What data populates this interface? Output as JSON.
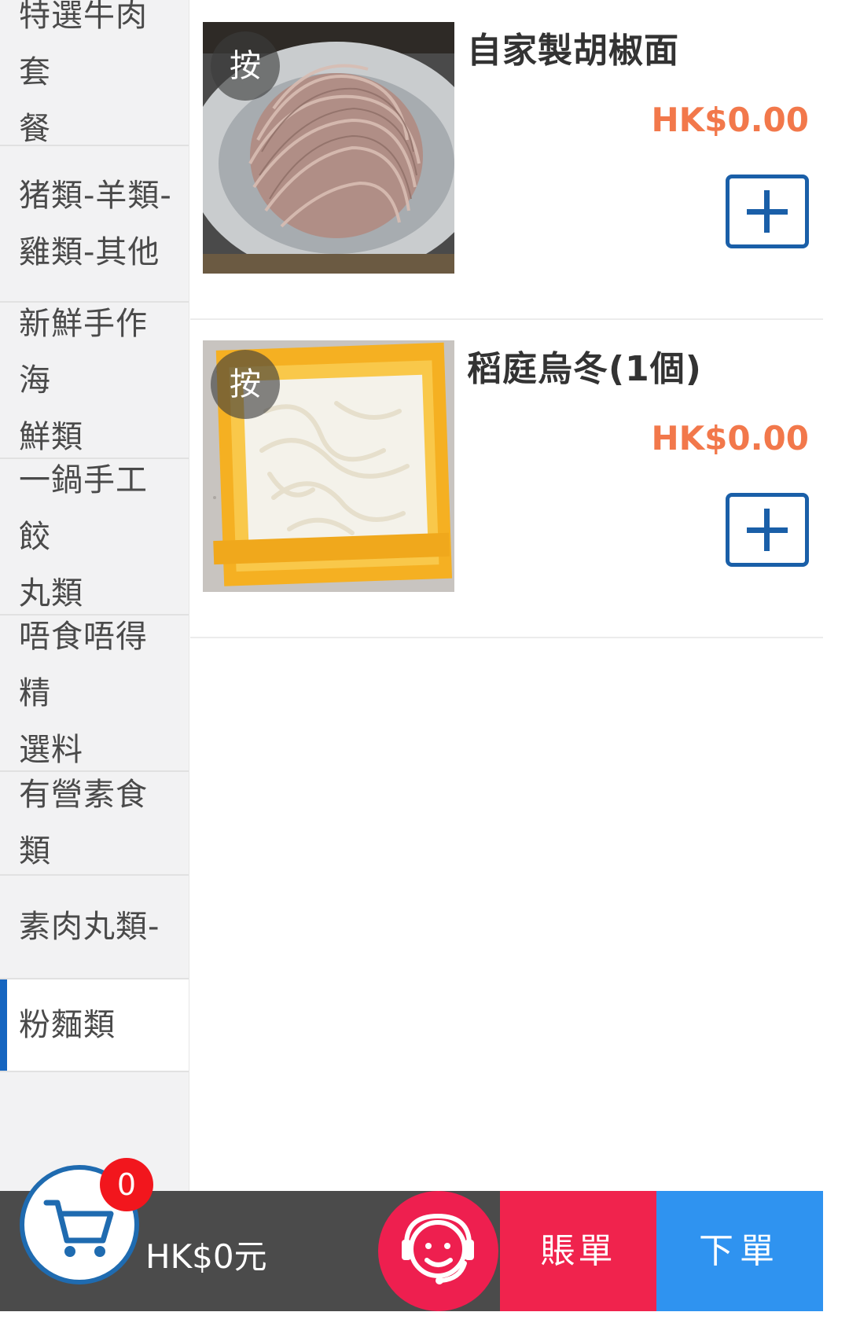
{
  "sidebar": {
    "categories": [
      {
        "line1": "特選牛肉套",
        "line2": "餐"
      },
      {
        "line1": "猪類-羊類-",
        "line2": "雞類-其他"
      },
      {
        "line1": "新鮮手作海",
        "line2": "鮮類"
      },
      {
        "line1": "一鍋手工餃",
        "line2": "丸類"
      },
      {
        "line1": "唔食唔得精",
        "line2": "選料"
      },
      {
        "line1": "有營素食類"
      },
      {
        "line1": "素肉丸類-"
      },
      {
        "line1": "粉麵類"
      }
    ],
    "active_index": 7
  },
  "products": [
    {
      "name": "自家製胡椒面",
      "price": "HK$0.00",
      "badge": "按",
      "image": "pepper-noodles-photo"
    },
    {
      "name": "稻庭烏冬(1個)",
      "price": "HK$0.00",
      "badge": "按",
      "image": "udon-photo"
    }
  ],
  "bottom_bar": {
    "cart_count": "0",
    "total": "HK$0元",
    "bill_label": "賬單",
    "order_label": "下單",
    "colors": {
      "bill": "#f0234d",
      "order": "#2f93f0",
      "service": "#ee1f4f",
      "bar": "#4b4b4b"
    }
  },
  "accent_colors": {
    "price": "#f2784b",
    "add_button": "#1a5fa8",
    "active_indicator": "#1565c0"
  }
}
